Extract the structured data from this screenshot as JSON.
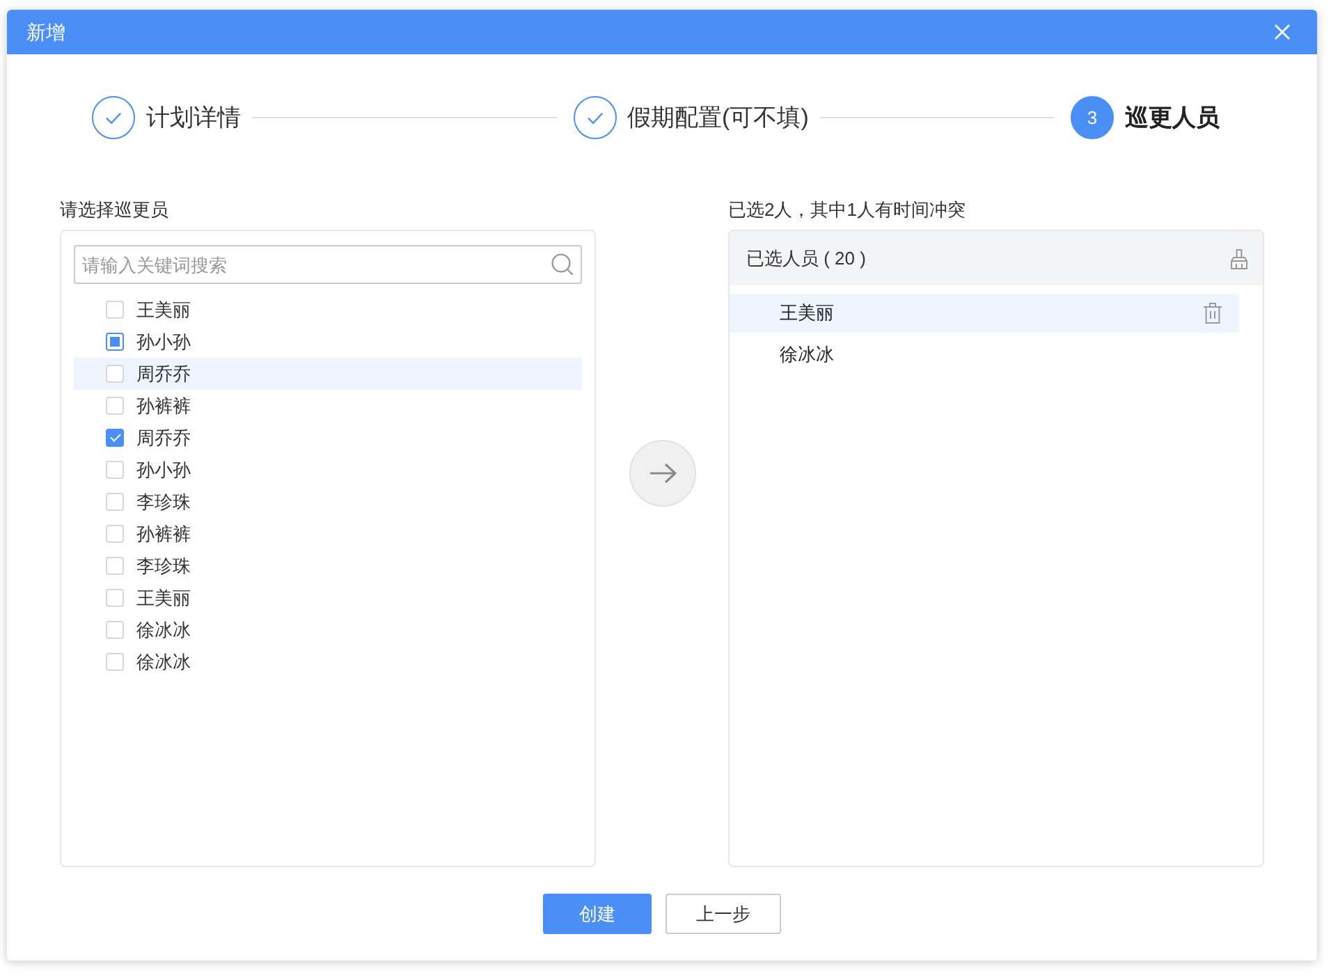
{
  "window": {
    "title": "新增"
  },
  "steps": [
    {
      "label": "计划详情",
      "done": true,
      "active": false
    },
    {
      "label": "假期配置(可不填)",
      "done": true,
      "active": false
    },
    {
      "label": "巡更人员",
      "number": "3",
      "done": false,
      "active": true
    }
  ],
  "source": {
    "label": "请选择巡更员",
    "search": {
      "placeholder": "请输入关键词搜索"
    },
    "items": [
      {
        "name": "王美丽",
        "checked": false,
        "indeterminate": false,
        "hovered": false
      },
      {
        "name": "孙小孙",
        "checked": false,
        "indeterminate": true,
        "hovered": false
      },
      {
        "name": "周乔乔",
        "checked": false,
        "indeterminate": false,
        "hovered": true
      },
      {
        "name": "孙裤裤",
        "checked": false,
        "indeterminate": false,
        "hovered": false
      },
      {
        "name": "周乔乔",
        "checked": true,
        "indeterminate": false,
        "hovered": false
      },
      {
        "name": "孙小孙",
        "checked": false,
        "indeterminate": false,
        "hovered": false
      },
      {
        "name": "李珍珠",
        "checked": false,
        "indeterminate": false,
        "hovered": false
      },
      {
        "name": "孙裤裤",
        "checked": false,
        "indeterminate": false,
        "hovered": false
      },
      {
        "name": "李珍珠",
        "checked": false,
        "indeterminate": false,
        "hovered": false
      },
      {
        "name": "王美丽",
        "checked": false,
        "indeterminate": false,
        "hovered": false
      },
      {
        "name": "徐冰冰",
        "checked": false,
        "indeterminate": false,
        "hovered": false
      },
      {
        "name": "徐冰冰",
        "checked": false,
        "indeterminate": false,
        "hovered": false
      }
    ]
  },
  "target": {
    "label": "已选2人，其中1人有时间冲突",
    "title": "已选人员 ( 20 )",
    "items": [
      {
        "name": "王美丽",
        "hovered": true
      },
      {
        "name": "徐冰冰",
        "hovered": false
      }
    ]
  },
  "buttons": [
    {
      "label": "创建",
      "kind": "primary"
    },
    {
      "label": "上一步",
      "kind": "default"
    }
  ]
}
